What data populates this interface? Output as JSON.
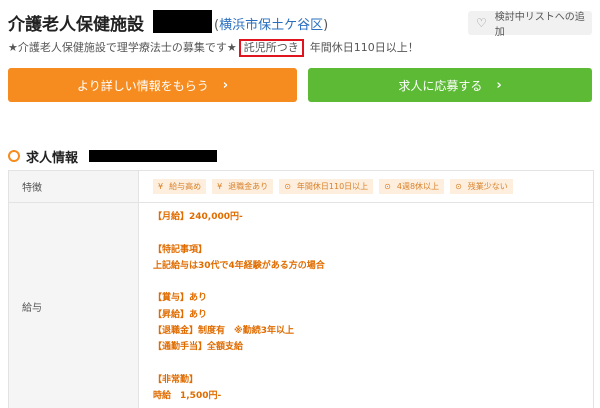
{
  "header": {
    "facility_type": "介護老人保健施設",
    "location_open": "(",
    "location_link": "横浜市保土ケ谷区",
    "location_close": ")",
    "wishlist_label": "検討中リストへの追加"
  },
  "subtitle": {
    "lead": "★介護老人保健施設で理学療法士の募集です★",
    "daycare": "託児所つき",
    "holidays": "年間休日110日以上！"
  },
  "buttons": {
    "more_info": "より詳しい情報をもらう",
    "apply": "求人に応募する"
  },
  "section": {
    "title": "求人情報"
  },
  "table": {
    "features_label": "特徴",
    "features": [
      {
        "icon": "yen-icon",
        "glyph": "¥",
        "label": "給与高め"
      },
      {
        "icon": "yen-icon",
        "glyph": "¥",
        "label": "退職金あり"
      },
      {
        "icon": "clock-icon",
        "glyph": "⊙",
        "label": "年間休日110日以上"
      },
      {
        "icon": "clock-icon",
        "glyph": "⊙",
        "label": "4週8休以上"
      },
      {
        "icon": "clock-icon",
        "glyph": "⊙",
        "label": "残業少ない"
      }
    ],
    "salary_label": "給与",
    "salary_lines": [
      "【月給】240,000円-",
      "",
      "【特記事項】",
      "上記給与は30代で4年経験がある方の場合",
      "",
      "【賞与】あり",
      "【昇給】あり",
      "【退職金】制度有　※勤続3年以上",
      "【通勤手当】全額支給",
      "",
      "【非常勤】",
      "時給　1,500円-"
    ]
  },
  "colors": {
    "orange": "#f68c1f",
    "green": "#5cba35",
    "highlight_red": "#e0141e",
    "link_blue": "#2a6fbf"
  }
}
